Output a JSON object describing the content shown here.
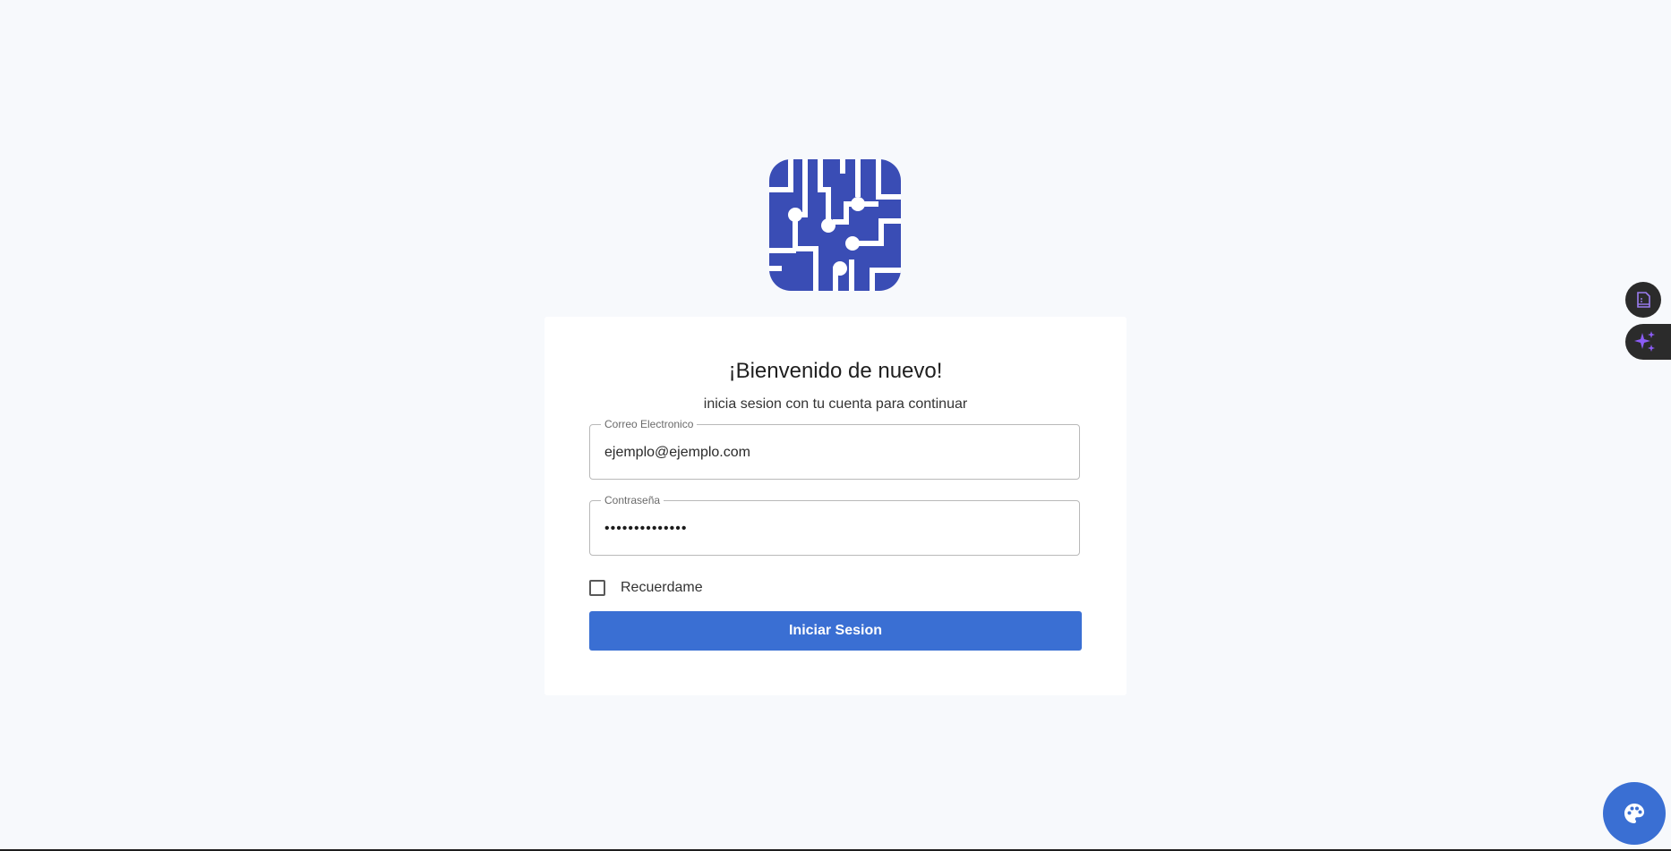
{
  "logo": {
    "icon": "circuit-logo",
    "color": "#3a4db5"
  },
  "login": {
    "title": "¡Bienvenido de nuevo!",
    "subtitle": "inicia sesion con tu cuenta para continuar",
    "email_label": "Correo Electronico",
    "email_value": "ejemplo@ejemplo.com",
    "password_label": "Contraseña",
    "password_value": "••••••••••••••",
    "remember_label": "Recuerdame",
    "remember_checked": false,
    "submit_label": "Iniciar Sesion"
  },
  "floating": {
    "doc_icon": "document-icon",
    "ai_icon": "sparkles-icon",
    "palette_icon": "palette-icon"
  },
  "colors": {
    "background": "#f7f9fc",
    "primary": "#3a6fd3",
    "logo": "#3a4db5",
    "ai_accent": "#8b5cf6"
  }
}
